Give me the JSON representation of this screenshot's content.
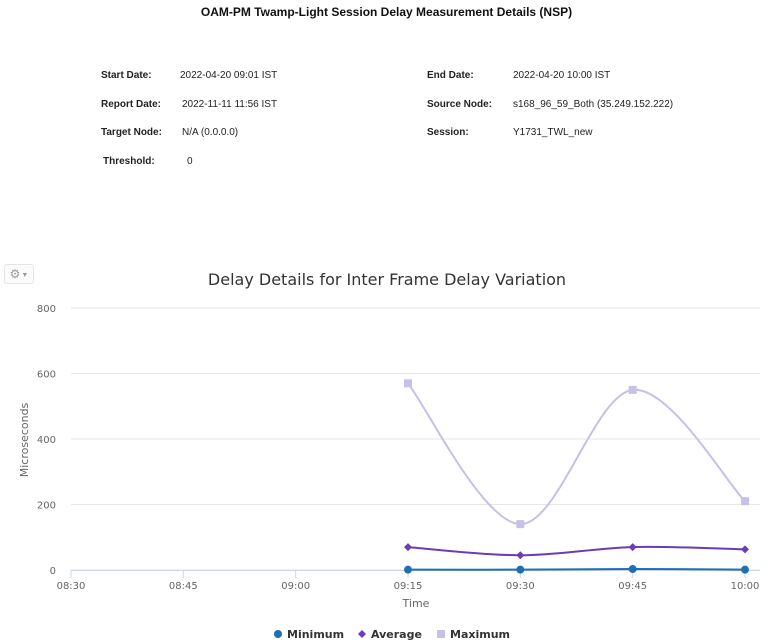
{
  "report": {
    "title": "OAM-PM Twamp-Light Session Delay Measurement Details (NSP)",
    "fields": {
      "start_date_label": "Start Date:",
      "start_date_value": "2022-04-20 09:01 IST",
      "end_date_label": "End Date:",
      "end_date_value": "2022-04-20 10:00 IST",
      "report_date_label": "Report Date:",
      "report_date_value": "2022-11-11 11:56 IST",
      "source_node_label": "Source Node:",
      "source_node_value": "s168_96_59_Both (35.249.152.222)",
      "target_node_label": "Target Node:",
      "target_node_value": "N/A (0.0.0.0)",
      "session_label": "Session:",
      "session_value": "Y1731_TWL_new",
      "threshold_label": "Threshold:",
      "threshold_value": "0"
    }
  },
  "toolbar": {
    "menu_icon": "gear-icon"
  },
  "chart_data": {
    "type": "line",
    "title": "Delay Details for Inter Frame Delay Variation",
    "xlabel": "Time",
    "ylabel": "Microseconds",
    "x_ticks": [
      "08:30",
      "08:45",
      "09:00",
      "09:15",
      "09:30",
      "09:45",
      "10:00"
    ],
    "x": [
      "09:15",
      "09:30",
      "09:45",
      "10:00"
    ],
    "ylim": [
      0,
      800
    ],
    "y_ticks": [
      0,
      200,
      400,
      600,
      800
    ],
    "grid": true,
    "legend_position": "bottom",
    "series": [
      {
        "name": "Minimum",
        "color": "#1f6fb5",
        "marker": "circle",
        "values": [
          1,
          1,
          3,
          1
        ]
      },
      {
        "name": "Average",
        "color": "#6a3db8",
        "marker": "diamond",
        "values": [
          70,
          45,
          70,
          63
        ]
      },
      {
        "name": "Maximum",
        "color": "#c8c0e6",
        "marker": "square",
        "values": [
          570,
          140,
          550,
          210
        ]
      }
    ]
  }
}
